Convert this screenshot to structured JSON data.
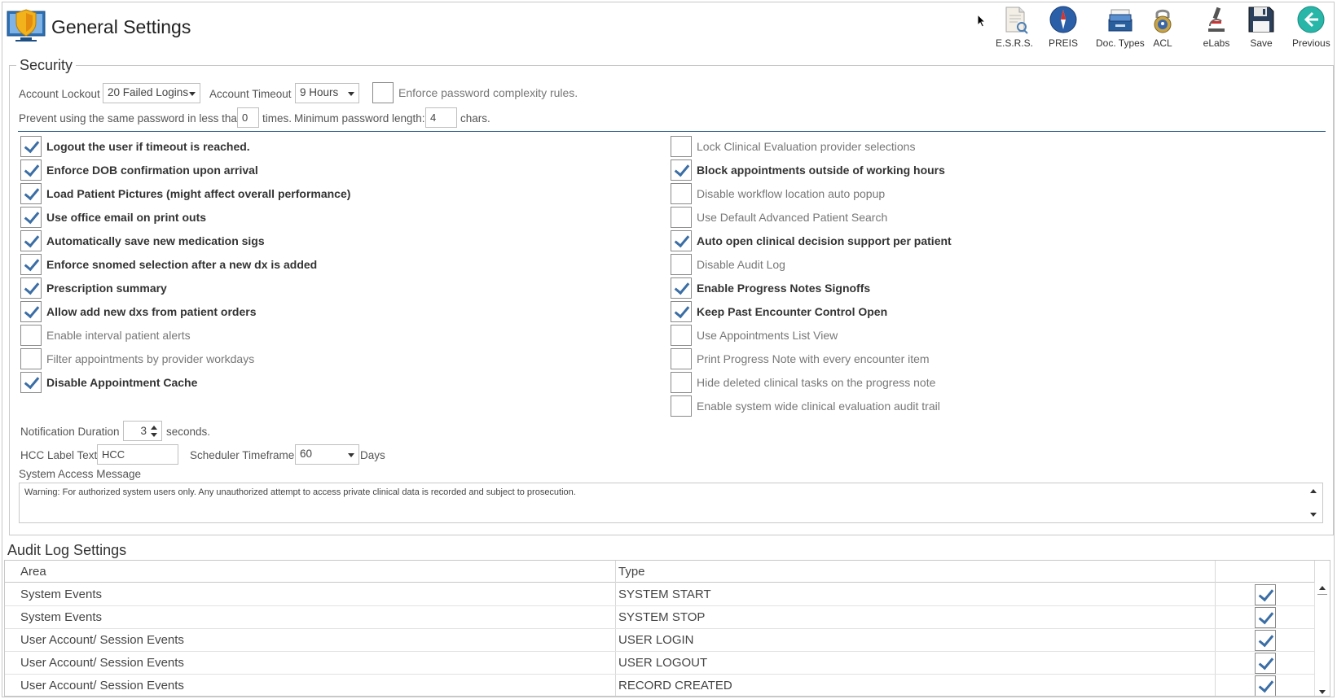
{
  "header": {
    "title": "General Settings",
    "toolbar": [
      {
        "label": "E.S.R.S.",
        "icon": "document-search-icon"
      },
      {
        "label": "PREIS",
        "icon": "compass-icon"
      },
      {
        "label": "Doc. Types",
        "icon": "document-stack-icon"
      },
      {
        "label": "ACL",
        "icon": "padlock-icon"
      },
      {
        "label": "eLabs",
        "icon": "microscope-icon"
      },
      {
        "label": "Save",
        "icon": "floppy-disk-icon"
      },
      {
        "label": "Previous",
        "icon": "back-arrow-icon"
      }
    ]
  },
  "security": {
    "legend": "Security",
    "account_lockout_label": "Account Lockout",
    "account_lockout_value": "20 Failed Logins",
    "account_timeout_label": "Account Timeout",
    "account_timeout_value": "9 Hours",
    "enforce_complexity_label": "Enforce password complexity rules.",
    "prevent_reuse_label": "Prevent using the same password in less than",
    "prevent_reuse_value": "0",
    "times_label": "times.",
    "min_length_label": "Minimum password length:",
    "min_length_value": "4",
    "chars_label": "chars.",
    "left_options": [
      {
        "label": "Logout the user if timeout is reached.",
        "checked": true
      },
      {
        "label": "Enforce DOB confirmation upon arrival",
        "checked": true
      },
      {
        "label": "Load Patient Pictures (might affect overall performance)",
        "checked": true
      },
      {
        "label": "Use office email on print outs",
        "checked": true
      },
      {
        "label": "Automatically save new medication sigs",
        "checked": true
      },
      {
        "label": "Enforce snomed selection after a new dx is added",
        "checked": true
      },
      {
        "label": "Prescription summary",
        "checked": true
      },
      {
        "label": "Allow add new dxs from patient orders",
        "checked": true
      },
      {
        "label": "Enable interval patient alerts",
        "checked": false
      },
      {
        "label": "Filter appointments by provider workdays",
        "checked": false
      },
      {
        "label": "Disable Appointment Cache",
        "checked": true
      }
    ],
    "right_options": [
      {
        "label": "Lock Clinical Evaluation provider selections",
        "checked": false
      },
      {
        "label": "Block appointments outside of working hours",
        "checked": true
      },
      {
        "label": "Disable workflow location auto popup",
        "checked": false
      },
      {
        "label": "Use Default Advanced Patient Search",
        "checked": false
      },
      {
        "label": "Auto open clinical decision support per patient",
        "checked": true
      },
      {
        "label": "Disable Audit Log",
        "checked": false
      },
      {
        "label": "Enable Progress Notes Signoffs",
        "checked": true
      },
      {
        "label": "Keep Past Encounter Control Open",
        "checked": true
      },
      {
        "label": "Use Appointments List View",
        "checked": false
      },
      {
        "label": "Print Progress Note with every encounter item",
        "checked": false
      },
      {
        "label": "Hide deleted clinical tasks on the progress note",
        "checked": false
      },
      {
        "label": "Enable system wide clinical evaluation audit trail",
        "checked": false
      }
    ],
    "notification_label": "Notification Duration",
    "notification_value": "3",
    "seconds_label": "seconds.",
    "hcc_label": "HCC Label Text:",
    "hcc_value": "HCC",
    "scheduler_label": "Scheduler Timeframe",
    "scheduler_value": "60",
    "days_label": "Days",
    "system_access_label": "System Access Message",
    "system_access_message": "Warning: For authorized system users only. Any unauthorized attempt to access private clinical data is recorded and subject to prosecution."
  },
  "audit": {
    "title": "Audit Log Settings",
    "columns": [
      "Area",
      "Type"
    ],
    "rows": [
      {
        "area": "System Events",
        "type": "SYSTEM START",
        "enabled": true
      },
      {
        "area": "System Events",
        "type": "SYSTEM STOP",
        "enabled": true
      },
      {
        "area": "User Account/ Session Events",
        "type": "USER LOGIN",
        "enabled": true
      },
      {
        "area": "User Account/ Session Events",
        "type": "USER LOGOUT",
        "enabled": true
      },
      {
        "area": "User Account/ Session Events",
        "type": "RECORD CREATED",
        "enabled": true
      }
    ]
  },
  "colors": {
    "accent": "#3b6ea5",
    "separator": "#2e5f8a",
    "border": "#c8c8c8"
  }
}
